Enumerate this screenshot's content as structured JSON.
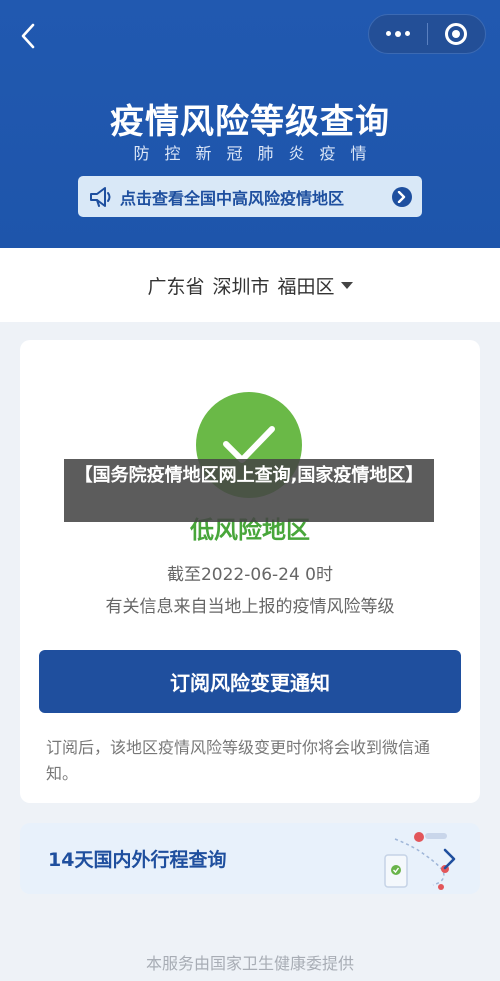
{
  "header": {
    "title": "疫情风险等级查询",
    "subtitle": "防控新冠肺炎疫情",
    "banner_text": "点击查看全国中高风险疫情地区",
    "icons": {
      "back": "chevron-left-icon",
      "more": "more-dots-icon",
      "close": "target-close-icon",
      "announce": "megaphone-icon",
      "go": "chevron-right-circle-icon"
    }
  },
  "region": {
    "province": "广东省",
    "city": "深圳市",
    "district": "福田区"
  },
  "result": {
    "risk_level": "低风险地区",
    "as_of": "截至2022-06-24 0时",
    "source_note": "有关信息来自当地上报的疫情风险等级",
    "subscribe_label": "订阅风险变更通知",
    "subscribe_desc": "订阅后，该地区疫情风险等级变更时你将会收到微信通知。"
  },
  "travel": {
    "label": "14天国内外行程查询"
  },
  "footer": {
    "text": "本服务由国家卫生健康委提供"
  },
  "overlay": {
    "caption": "【国务院疫情地区网上查询,国家疫情地区】"
  },
  "colors": {
    "header_bg": "#1f56ad",
    "accent": "#1f4f9e",
    "low_risk": "#6ab947"
  }
}
